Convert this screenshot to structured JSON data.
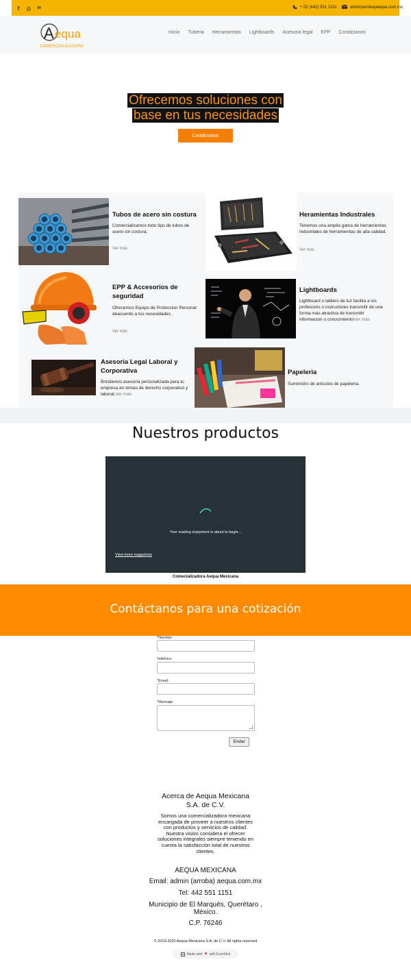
{
  "topbar": {
    "social": [
      {
        "name": "facebook-icon",
        "glyph": "f"
      },
      {
        "name": "instagram-icon",
        "glyph": "◎"
      },
      {
        "name": "linkedin-icon",
        "glyph": "in"
      }
    ],
    "phone": "+ 52 (442) 551 1151",
    "email": "admin(arroba)aequa.com.mx",
    "color": "#f5b400"
  },
  "logo": {
    "wordmark": "Aequa",
    "tagline": "COMERCIALIZADORA"
  },
  "nav": [
    "Inicio",
    "Tuberia",
    "Herramientas",
    "Lightboards",
    "Asesoria legal",
    "EPP",
    "Contáctanos"
  ],
  "hero": {
    "line1": "Ofrecemos soluciones con",
    "line2": "base en tus necesidades",
    "button": "Contáctanos",
    "accent": "#f7941d"
  },
  "services": {
    "tubos": {
      "title": "Tubos de acero sin costura",
      "desc": "Comercializamos todo tipo de tubos de acero sin costura.",
      "more": "Ver más"
    },
    "herramientas": {
      "title": "Heramientas Industrales",
      "desc": "Tenemos una amplia gama de herramientas industriales de herramientas de alta calidad.",
      "more": "Ver más"
    },
    "epp": {
      "title": "EPP & Accesorios de seguridad",
      "desc": "Ofrecemos Equipo de Proteccion Personal deacuerdo a tus necesidades .",
      "more": "Ver más"
    },
    "lightboards": {
      "title": "Lightboards",
      "desc": "Lightboard o tablero de luz facilita a los profesores o instructores transmitir de una forma más atractiva de transmitir informacion o conocimiento",
      "more": "Ver más"
    },
    "legal": {
      "title": "Asesoria Legal Laboral y Corporativa",
      "desc": "Brindamos asesoria personalizada para tu empresa en temas de derecho corporativo y laboral.",
      "more": "Ver más"
    },
    "papeleria": {
      "title": "Papeleria",
      "desc": "Suministro de articulos de papeleria."
    }
  },
  "products": {
    "title": "Nuestros productos",
    "loading": "Your reading enjoyment is about to begin...",
    "more": "View more magazines",
    "caption": "Comecializadora Aequa Mexicana"
  },
  "cta": {
    "title": "Contáctanos para una cotización",
    "color": "#ff8a00"
  },
  "form": {
    "nombre": "*Nombre:",
    "telefono": "Teléfono:",
    "email": "*Email:",
    "mensaje": "*Mensaje:",
    "submit": "Enviar"
  },
  "about": {
    "title1": "Acerca de Aequa Mexicana",
    "title2": "S.A. de C.V.",
    "body": [
      "Somos una comercializadora mexicana",
      "encargada de proveer a nuestros clientes",
      "con productos y servicios de calidad.",
      "Nuestra visión considera el ofrecer",
      "soluciones integrales siempre teniendo en",
      "cuenta la satisfacción total de nuestros",
      "clientes."
    ]
  },
  "company": {
    "name": "AEQUA MEXICANA",
    "email": "Email: admin (arroba) aequa.com.mx",
    "tel": "Tel: 442 551 1151",
    "address1": "Municipio de El Marqués, Querétaro ,",
    "address2": "México.",
    "cp": "C.P. 76246"
  },
  "footer": {
    "copyright": "© 2019-2020 Aequa Mexicana S.A. de C.V. All rights reserved",
    "made": "Made with",
    "with": "with EverWeb"
  }
}
